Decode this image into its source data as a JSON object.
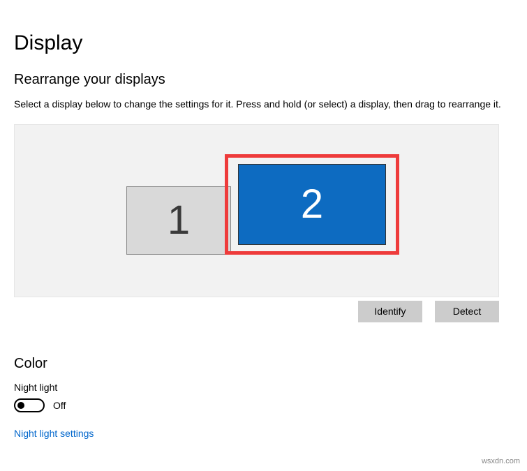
{
  "page": {
    "title": "Display"
  },
  "rearrange": {
    "heading": "Rearrange your displays",
    "instruction": "Select a display below to change the settings for it. Press and hold (or select) a display, then drag to rearrange it.",
    "monitors": {
      "m1": {
        "label": "1"
      },
      "m2": {
        "label": "2"
      }
    },
    "identify_label": "Identify",
    "detect_label": "Detect"
  },
  "color": {
    "heading": "Color",
    "night_light": {
      "label": "Night light",
      "state": "Off",
      "toggled": false
    },
    "settings_link": "Night light settings"
  },
  "watermark": "wsxdn.com"
}
